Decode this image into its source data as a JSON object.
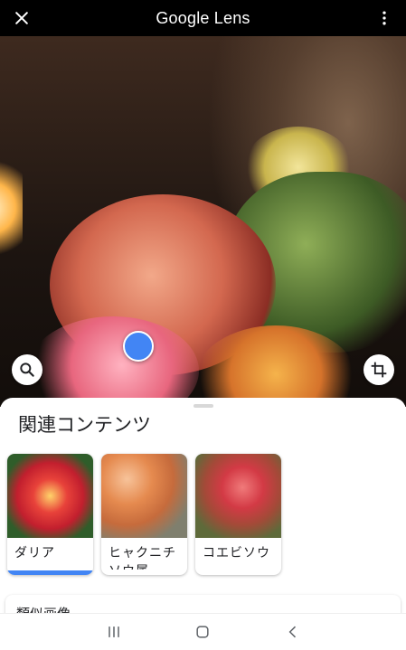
{
  "topbar": {
    "title": "Google Lens",
    "close_icon": "close-icon",
    "more_icon": "more-vert-icon"
  },
  "image_actions": {
    "search_icon": "search-icon",
    "crop_icon": "crop-icon"
  },
  "results": {
    "section_title": "関連コンテンツ",
    "items": [
      {
        "label": "ダリア",
        "selected": true
      },
      {
        "label": "ヒャクニチソウ属",
        "selected": false
      },
      {
        "label": "コエビソウ",
        "selected": false
      }
    ],
    "similar_title": "類似画像"
  },
  "navbar": {
    "recents_icon": "recents-icon",
    "home_icon": "home-icon",
    "back_icon": "back-icon"
  },
  "colors": {
    "accent": "#4285f4",
    "topbar": "#000000"
  }
}
